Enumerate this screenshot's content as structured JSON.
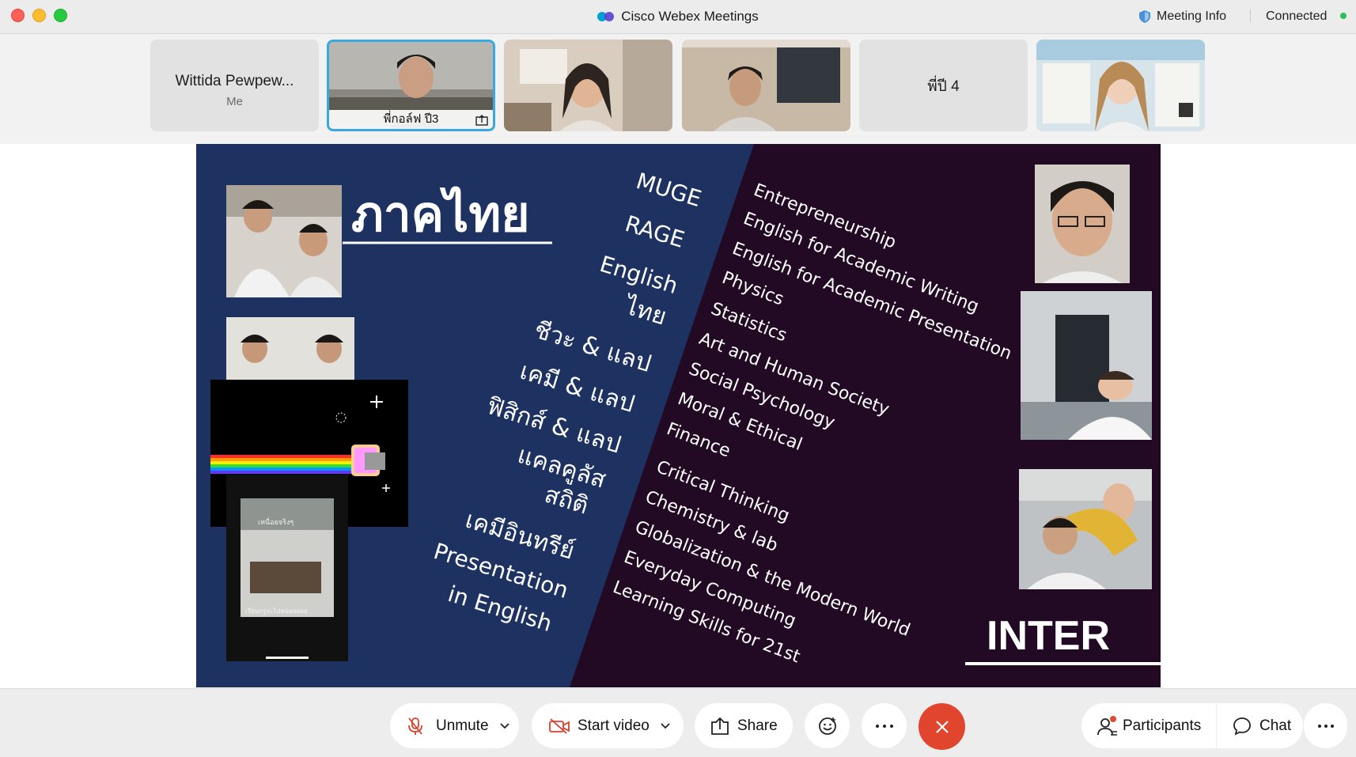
{
  "window": {
    "title": "Cisco Webex Meetings",
    "meeting_info_label": "Meeting Info",
    "status_label": "Connected"
  },
  "participants_strip": [
    {
      "name": "Wittida Pewpew...",
      "subtitle": "Me",
      "video": false
    },
    {
      "name": "พี่กอล์ฟ ปี3",
      "video": true,
      "active_speaker": true,
      "sharing": true
    },
    {
      "name": "",
      "video": true
    },
    {
      "name": "",
      "video": true
    },
    {
      "name": "พี่ปี 4",
      "video": false
    },
    {
      "name": "",
      "video": true
    }
  ],
  "slide": {
    "thai_title": "ภาคไทย",
    "inter_title": "INTER",
    "thai_subjects": [
      "MUGE",
      "RAGE",
      "English",
      "ไทย",
      "ชีวะ & แลป",
      "เคมี & แลป",
      "ฟิสิกส์ & แลป",
      "แคลคูลัส",
      "สถิติ",
      "เคมีอินทรีย์",
      "Presentation",
      "in English"
    ],
    "inter_subjects": [
      "Entrepreneurship",
      "English for Academic Writing",
      "English for Academic Presentation",
      "Physics",
      "Statistics",
      "Art and Human Society",
      "Social Psychology",
      "Moral & Ethical",
      "Finance",
      "Critical Thinking",
      "Chemistry & lab",
      "Globalization & the Modern World",
      "Everyday Computing",
      "Learning Skills for 21st"
    ],
    "phone_overlay_text": [
      "เหนื่อยจริงๆ",
      "เรียนกรูจะไปหน่อยยยย"
    ]
  },
  "toolbar": {
    "unmute_label": "Unmute",
    "start_video_label": "Start video",
    "share_label": "Share",
    "participants_label": "Participants",
    "chat_label": "Chat"
  },
  "colors": {
    "end_call": "#e1452e",
    "active_border": "#3aa7e0",
    "slide_blue": "#1e3262",
    "slide_purple": "#230a24",
    "notification_dot": "#e04a2f"
  },
  "icons": [
    "mic-muted-icon",
    "video-off-icon",
    "share-icon",
    "reactions-icon",
    "more-icon",
    "end-call-icon",
    "participants-icon",
    "chat-icon",
    "shield-icon"
  ]
}
